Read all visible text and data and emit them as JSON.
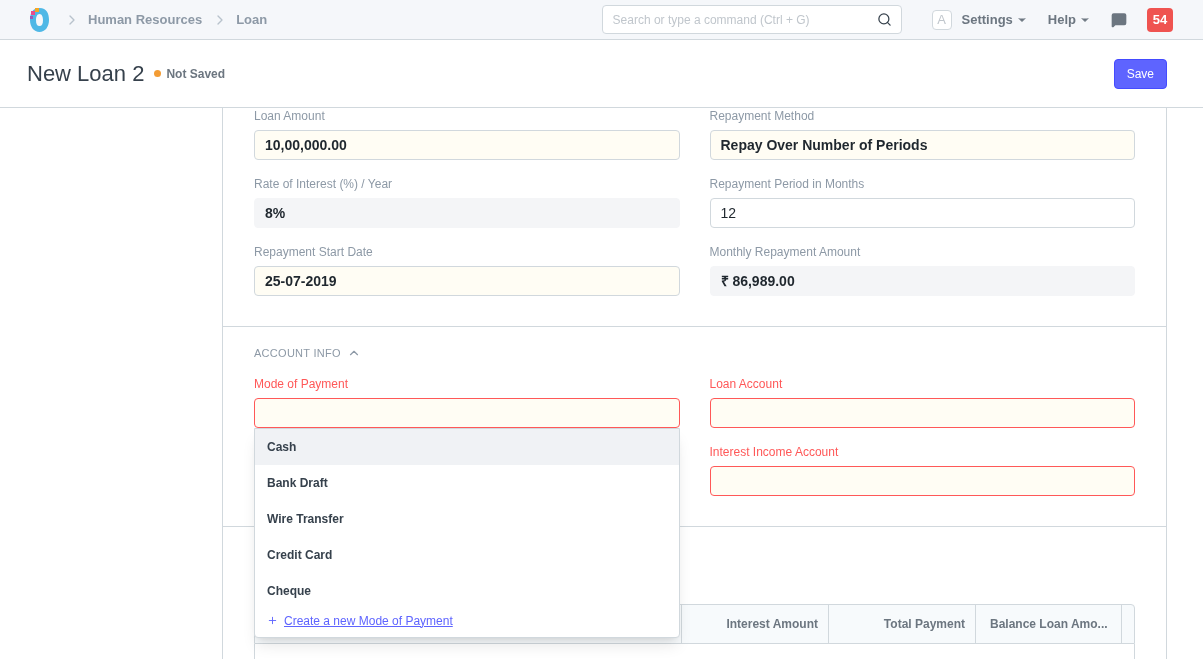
{
  "navbar": {
    "breadcrumbs": [
      "Human Resources",
      "Loan"
    ],
    "search": {
      "placeholder": "Search or type a command (Ctrl + G)"
    },
    "avatar": "A",
    "menus": [
      "Settings",
      "Help"
    ],
    "notification_count": "54"
  },
  "page": {
    "title": "New Loan 2",
    "status": "Not Saved",
    "primary_action": "Save"
  },
  "loan_fields": [
    {
      "label": "Loan Amount",
      "value": "10,00,000.00",
      "kind": "input"
    },
    {
      "label": "Repayment Method",
      "value": "Repay Over Number of Periods",
      "kind": "input"
    },
    {
      "label": "Rate of Interest (%) / Year",
      "value": "8%",
      "kind": "readonly"
    },
    {
      "label": "Repayment Period in Months",
      "value": "12",
      "kind": "plain"
    },
    {
      "label": "Repayment Start Date",
      "value": "25-07-2019",
      "kind": "input"
    },
    {
      "label": "Monthly Repayment Amount",
      "value": "₹ 86,989.00",
      "kind": "readonly"
    }
  ],
  "account_info": {
    "title": "ACCOUNT INFO",
    "expanded": true,
    "fields": [
      {
        "label": "Mode of Payment",
        "required_missing": true
      },
      {
        "label": "Loan Account",
        "required_missing": true
      },
      {
        "label": "Interest Income Account",
        "required_missing": true
      }
    ],
    "dropdown": {
      "options": [
        {
          "label": "Cash",
          "selected": true
        },
        {
          "label": "Bank Draft",
          "selected": false
        },
        {
          "label": "Wire Transfer",
          "selected": false
        },
        {
          "label": "Credit Card",
          "selected": false
        },
        {
          "label": "Cheque",
          "selected": false
        }
      ],
      "create_link": "Create a new Mode of Payment"
    }
  },
  "schedule_table": {
    "columns": [
      "Interest Amount",
      "Total Payment",
      "Balance Loan Amo..."
    ]
  }
}
